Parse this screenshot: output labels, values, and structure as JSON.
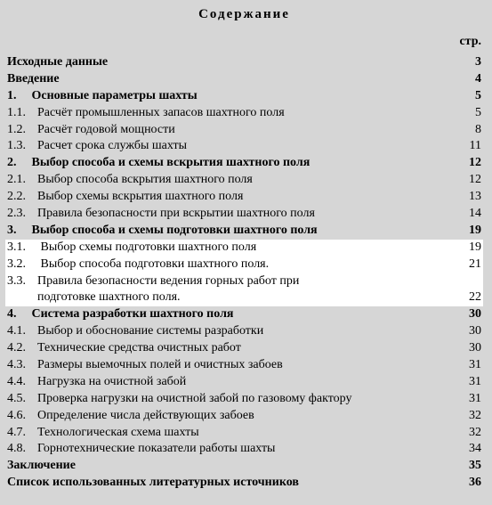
{
  "title": "Содержание",
  "page_label": "стр.",
  "rows": [
    {
      "kind": "plain",
      "bold": true,
      "highlight": false,
      "text": "Исходные данные",
      "page": "3"
    },
    {
      "kind": "plain",
      "bold": true,
      "highlight": false,
      "text": "Введение",
      "page": "4"
    },
    {
      "kind": "main",
      "bold": true,
      "highlight": false,
      "num": "1.",
      "text": "Основные параметры шахты",
      "page": "5"
    },
    {
      "kind": "sub",
      "bold": false,
      "highlight": false,
      "num": "1.1.",
      "text": "Расчёт промышленных запасов шахтного поля",
      "page": "5"
    },
    {
      "kind": "sub",
      "bold": false,
      "highlight": false,
      "num": "1.2.",
      "text": "Расчёт годовой мощности",
      "page": "8"
    },
    {
      "kind": "sub",
      "bold": false,
      "highlight": false,
      "num": "1.3.",
      "text": "Расчет срока службы шахты",
      "page": "11"
    },
    {
      "kind": "main",
      "bold": true,
      "highlight": false,
      "num": "2.",
      "text": "Выбор способа и схемы вскрытия шахтного поля",
      "page": "12"
    },
    {
      "kind": "sub",
      "bold": false,
      "highlight": false,
      "num": "2.1.",
      "text": "Выбор способа вскрытия шахтного поля",
      "page": "12"
    },
    {
      "kind": "sub",
      "bold": false,
      "highlight": false,
      "num": "2.2.",
      "text": "Выбор схемы вскрытия шахтного поля",
      "page": "13"
    },
    {
      "kind": "sub",
      "bold": false,
      "highlight": false,
      "num": "2.3.",
      "text": "Правила безопасности при вскрытии шахтного поля",
      "page": "14"
    },
    {
      "kind": "main",
      "bold": true,
      "highlight": false,
      "num": "3.",
      "text": "Выбор способа и схемы подготовки шахтного поля",
      "page": "19"
    },
    {
      "kind": "sub",
      "bold": false,
      "highlight": true,
      "num": "3.1.",
      "text": " Выбор схемы подготовки шахтного поля",
      "page": "19"
    },
    {
      "kind": "sub",
      "bold": false,
      "highlight": true,
      "num": "3.2.",
      "text": " Выбор способа подготовки шахтного поля.",
      "page": "21"
    },
    {
      "kind": "sub",
      "bold": false,
      "highlight": true,
      "num": "3.3.",
      "text": "Правила безопасности ведения горных работ при",
      "page": ""
    },
    {
      "kind": "cont",
      "bold": false,
      "highlight": true,
      "text": "подготовке шахтного поля.",
      "page": "22"
    },
    {
      "kind": "main",
      "bold": true,
      "highlight": false,
      "num": "4.",
      "text": "Система разработки шахтного поля",
      "page": "30"
    },
    {
      "kind": "sub",
      "bold": false,
      "highlight": false,
      "num": "4.1.",
      "text": "Выбор и обоснование системы разработки",
      "page": "30"
    },
    {
      "kind": "sub",
      "bold": false,
      "highlight": false,
      "num": "4.2.",
      "text": "Технические средства очистных работ",
      "page": "30"
    },
    {
      "kind": "sub",
      "bold": false,
      "highlight": false,
      "num": "4.3.",
      "text": "Размеры выемочных полей и очистных забоев",
      "page": "31"
    },
    {
      "kind": "sub",
      "bold": false,
      "highlight": false,
      "num": "4.4.",
      "text": "Нагрузка на очистной забой",
      "page": "31"
    },
    {
      "kind": "sub",
      "bold": false,
      "highlight": false,
      "num": "4.5.",
      "text": "Проверка нагрузки на очистной забой по газовому фактору",
      "page": "31"
    },
    {
      "kind": "sub",
      "bold": false,
      "highlight": false,
      "num": "4.6.",
      "text": "Определение числа действующих забоев",
      "page": "32"
    },
    {
      "kind": "sub",
      "bold": false,
      "highlight": false,
      "num": "4.7.",
      "text": "Технологическая схема шахты",
      "page": "32"
    },
    {
      "kind": "sub",
      "bold": false,
      "highlight": false,
      "num": "4.8.",
      "text": "Горнотехнические показатели работы шахты",
      "page": "34"
    },
    {
      "kind": "plain",
      "bold": true,
      "highlight": false,
      "text": "Заключение",
      "page": "35"
    },
    {
      "kind": "plain",
      "bold": true,
      "highlight": false,
      "text": "Список использованных литературных источников",
      "page": "36"
    }
  ]
}
